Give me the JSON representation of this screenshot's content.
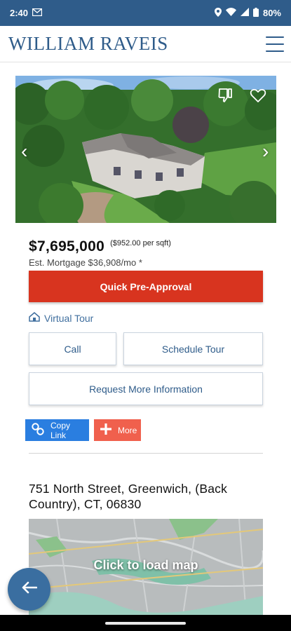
{
  "status_bar": {
    "time": "2:40",
    "battery": "80%",
    "icons": [
      "gmail-icon",
      "location-icon",
      "wifi-icon",
      "signal-icon",
      "battery-icon"
    ]
  },
  "header": {
    "logo": "WILLIAM RAVEIS",
    "menu_icon": "hamburger-menu-icon"
  },
  "photo": {
    "icons": [
      "thumbs-down-icon",
      "heart-icon",
      "chevron-left-icon",
      "chevron-right-icon"
    ],
    "prev_glyph": "‹",
    "next_glyph": "›"
  },
  "listing": {
    "price": "$7,695,000",
    "price_per_sqft": "($952.00 per sqft)",
    "mortgage": "Est. Mortgage $36,908/mo *",
    "address": "751 North Street, Greenwich, (Back Country), CT, 06830"
  },
  "actions": {
    "pre_approval": "Quick Pre-Approval",
    "virtual_tour": "Virtual Tour",
    "call": "Call",
    "schedule_tour": "Schedule Tour",
    "request_info": "Request More Information",
    "copy_link": "Copy Link",
    "more": "More"
  },
  "map": {
    "label": "Click to load map"
  },
  "colors": {
    "brand_blue": "#2f5c8a",
    "cta_red": "#d8341f",
    "copy_link_blue": "#2a7ee0",
    "more_red": "#f0604d",
    "fab_blue": "#3a6ea0"
  }
}
